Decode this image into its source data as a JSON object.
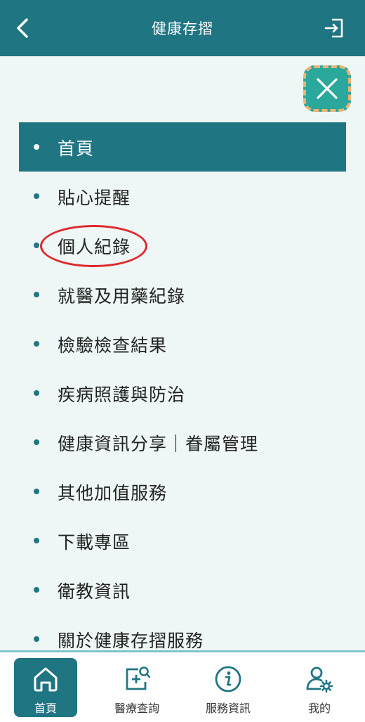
{
  "header": {
    "title": "健康存摺"
  },
  "menu": {
    "items": [
      {
        "label": "首頁",
        "active": true
      },
      {
        "label": "貼心提醒"
      },
      {
        "label": "個人紀錄"
      },
      {
        "label": "就醫及用藥紀錄"
      },
      {
        "label": "檢驗檢查結果"
      },
      {
        "label": "疾病照護與防治"
      },
      {
        "label": "健康資訊分享｜眷屬管理"
      },
      {
        "label": "其他加值服務"
      },
      {
        "label": "下載專區"
      },
      {
        "label": "衛教資訊"
      },
      {
        "label": "關於健康存摺服務"
      }
    ]
  },
  "bottom_nav": {
    "items": [
      {
        "label": "首頁",
        "icon": "home-icon",
        "active": true
      },
      {
        "label": "醫療查詢",
        "icon": "medical-search-icon"
      },
      {
        "label": "服務資訊",
        "icon": "info-icon"
      },
      {
        "label": "我的",
        "icon": "user-settings-icon"
      }
    ]
  },
  "colors": {
    "primary": "#1f7582",
    "background": "#eef6f6",
    "close_button": "#2aa89b",
    "close_border": "#e9b477",
    "highlight": "#e0282b",
    "nav_border": "#7fc3c8"
  }
}
